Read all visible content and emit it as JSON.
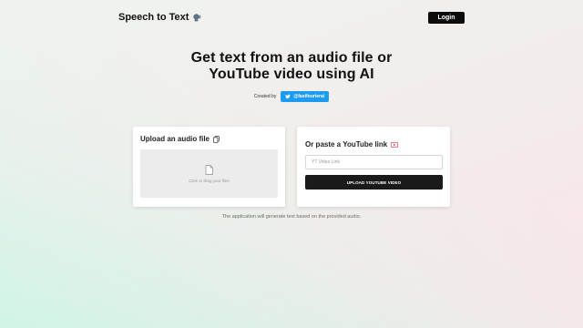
{
  "header": {
    "logo_text": "Speech to Text",
    "logo_icon": "speaking-head-icon",
    "login_label": "Login"
  },
  "hero": {
    "title_line1": "Get text from an audio file or",
    "title_line2": "YouTube video using AI",
    "created_by": "Created by",
    "twitter_handle": "@fastfourierai",
    "twitter_color": "#1d9bf0"
  },
  "upload_card": {
    "title": "Upload an audio file",
    "title_icon": "copy-file-icon",
    "dropzone_text": "Click or drag your files"
  },
  "youtube_card": {
    "title": "Or paste a YouTube link",
    "title_icon": "youtube-icon",
    "youtube_icon_color": "#e0334a",
    "input_placeholder": "YT Video Link",
    "input_value": "",
    "button_label": "UPLOAD YOUTUBE VIDEO"
  },
  "footer": {
    "note": "The application will generate text based on the provided audio."
  }
}
